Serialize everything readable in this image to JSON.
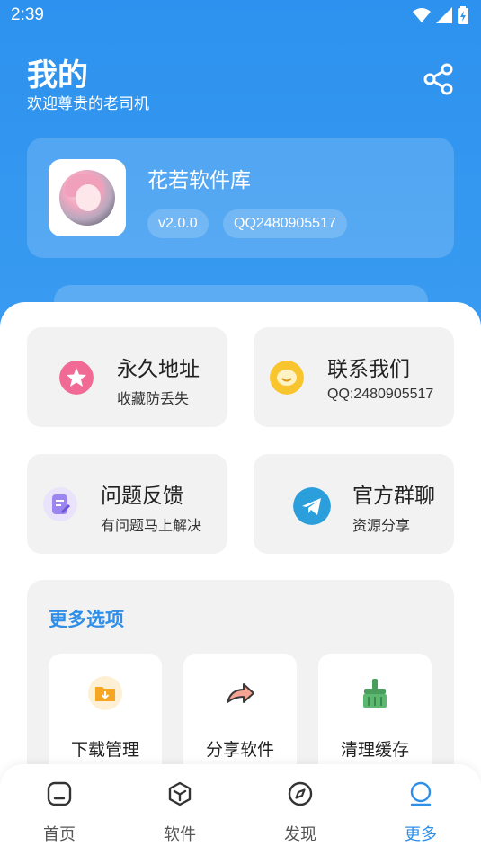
{
  "status_bar": {
    "time": "2:39"
  },
  "header": {
    "title": "我的",
    "subtitle": "欢迎尊贵的老司机"
  },
  "profile": {
    "app_name": "花若软件库",
    "version": "v2.0.0",
    "qq": "QQ2480905517"
  },
  "cards": [
    {
      "title": "永久地址",
      "subtitle": "收藏防丢失",
      "icon": "star-icon",
      "color": "#f06a95"
    },
    {
      "title": "联系我们",
      "subtitle": "QQ:2480905517",
      "icon": "chat-icon",
      "color": "#f8c52e"
    },
    {
      "title": "问题反馈",
      "subtitle": "有问题马上解决",
      "icon": "feedback-icon",
      "color": "#9a86ee"
    },
    {
      "title": "官方群聊",
      "subtitle": "资源分享",
      "icon": "telegram-icon",
      "color": "#2a9fdc"
    }
  ],
  "more_options": {
    "heading": "更多选项",
    "items": [
      {
        "label": "下载管理",
        "icon": "download-folder-icon"
      },
      {
        "label": "分享软件",
        "icon": "share-arrow-icon"
      },
      {
        "label": "清理缓存",
        "icon": "broom-icon"
      }
    ]
  },
  "tabbar": {
    "items": [
      {
        "label": "首页",
        "icon": "home-icon"
      },
      {
        "label": "软件",
        "icon": "cube-icon"
      },
      {
        "label": "发现",
        "icon": "compass-icon"
      },
      {
        "label": "更多",
        "icon": "more-icon",
        "active": true
      }
    ]
  },
  "colors": {
    "primary": "#2f95ee",
    "accent": "#2f8fe8",
    "card_bg": "#f2f2f2"
  }
}
